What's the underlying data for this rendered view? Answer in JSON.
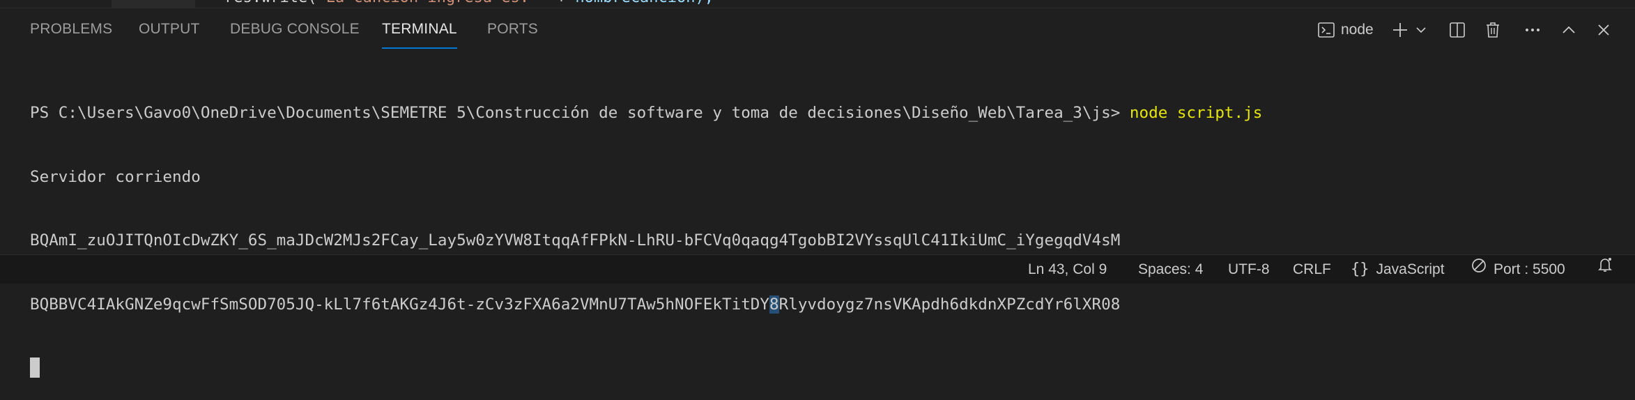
{
  "editor_peek": {
    "code_fragment_a": "res.write(",
    "code_fragment_b": "\"La cancion ingresa es: \"",
    "code_fragment_c": " + ",
    "code_fragment_d": "nombreCancion);"
  },
  "panel": {
    "tabs": [
      {
        "label": "PROBLEMS",
        "active": false
      },
      {
        "label": "OUTPUT",
        "active": false
      },
      {
        "label": "DEBUG CONSOLE",
        "active": false
      },
      {
        "label": "TERMINAL",
        "active": true
      },
      {
        "label": "PORTS",
        "active": false
      }
    ],
    "terminal_profile_label": "node",
    "icons": {
      "terminal": "terminal-icon",
      "new_terminal": "plus-icon",
      "dropdown": "chevron-down-icon",
      "split": "split-terminal-icon",
      "kill": "trash-icon",
      "more": "ellipsis-icon",
      "maximize": "chevron-up-icon",
      "close": "close-icon"
    }
  },
  "terminal": {
    "prompt": "PS C:\\Users\\Gavo0\\OneDrive\\Documents\\SEMETRE 5\\Construcción de software y toma de decisiones\\Diseño_Web\\Tarea_3\\js> ",
    "command": "node script.js",
    "output_lines": [
      "Servidor corriendo",
      "BQAmI_zuOJITQnOIcDwZKY_6S_maJDcW2MJs2FCay_Lay5w0zYVW8ItqqAfFPkN-LhRU-bFCVq0qaqg4TgobBI2VYssqUlC41IkiUmC_iYgegqdV4sM"
    ],
    "token_line_before": "BQBBVC4IAkGNZe9qcwFfSmSOD705JQ-kLl7f6tAKGz4J6t-zCv3zFXA6a2VMnU7TAw5hNOFEkTitDY",
    "token_line_selected": "8",
    "token_line_after": "Rlyvdoygz7nsVKApdh6dkdnXPZcdYr6lXR08"
  },
  "status_bar": {
    "position": "Ln 43, Col 9",
    "spaces": "Spaces: 4",
    "encoding": "UTF-8",
    "eol": "CRLF",
    "language": "JavaScript",
    "port": "Port : 5500",
    "icons": {
      "language": "braces-icon",
      "port": "broadcast-icon",
      "notifications": "bell-icon"
    }
  },
  "colors": {
    "background": "#1f1f1f",
    "accent": "#0078d4",
    "command": "#e5e510",
    "selection": "#264f78",
    "text": "#cccccc"
  }
}
